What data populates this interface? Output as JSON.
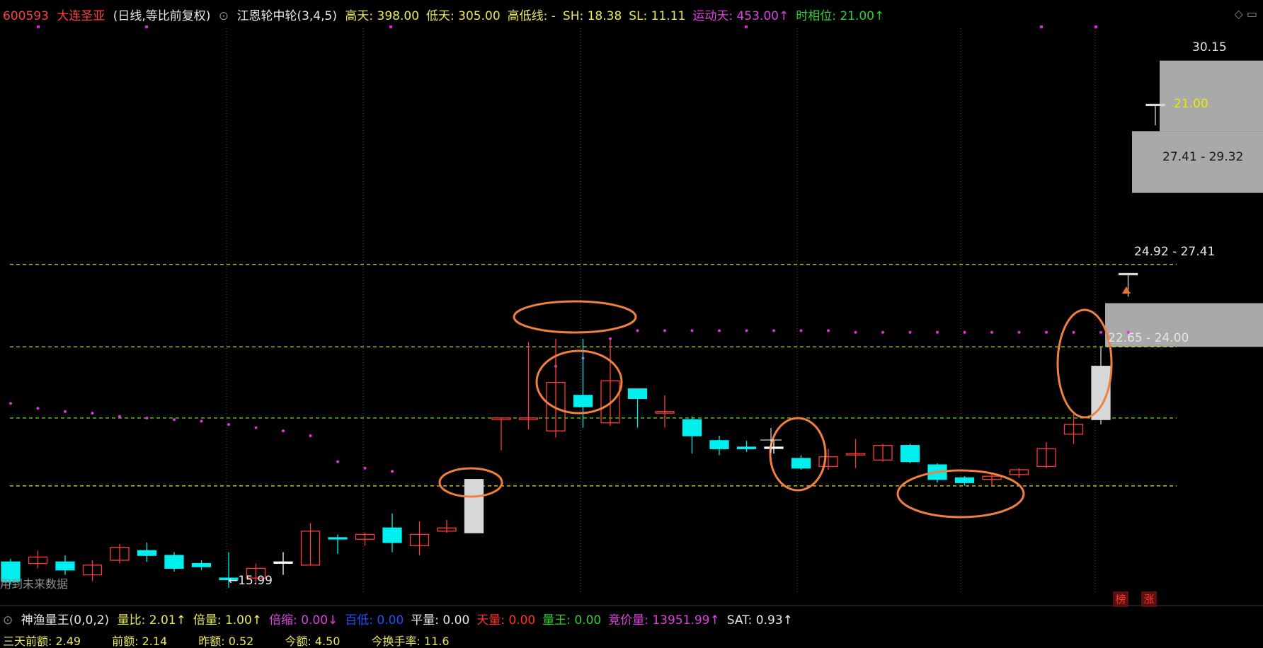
{
  "header": {
    "code": "600593",
    "name": "大连圣亚",
    "period": "(日线,等比前复权)",
    "indicator_name": "江恩轮中轮(3,4,5)",
    "items": [
      {
        "label": "高天: 398.00",
        "color": "#e8e85a"
      },
      {
        "label": "低天: 305.00",
        "color": "#e8e85a"
      },
      {
        "label": "高低线: -",
        "color": "#e8e85a"
      },
      {
        "label": "SH: 18.38",
        "color": "#e8e85a"
      },
      {
        "label": "SL: 11.11",
        "color": "#e8e85a"
      },
      {
        "label": "运动天: 453.00↑",
        "color": "#e040e0"
      },
      {
        "label": "时相位: 21.00↑",
        "color": "#30d030"
      }
    ]
  },
  "chart_data": {
    "type": "candlestick",
    "up_color": "#ff3b3b",
    "down_color": "#00f0f0",
    "limit_up_color": "#d8d8d8",
    "candles": [
      {
        "o": 15.4,
        "c": 16.0,
        "h": 16.1,
        "l": 15.3,
        "dir": "down"
      },
      {
        "o": 15.95,
        "c": 16.15,
        "h": 16.35,
        "l": 15.8,
        "dir": "up"
      },
      {
        "o": 16.0,
        "c": 15.75,
        "h": 16.2,
        "l": 15.6,
        "dir": "down"
      },
      {
        "o": 15.6,
        "c": 15.9,
        "h": 16.05,
        "l": 15.4,
        "dir": "up"
      },
      {
        "o": 16.05,
        "c": 16.45,
        "h": 16.55,
        "l": 15.95,
        "dir": "up"
      },
      {
        "o": 16.2,
        "c": 16.35,
        "h": 16.6,
        "l": 16.0,
        "dir": "down"
      },
      {
        "o": 16.2,
        "c": 15.8,
        "h": 16.3,
        "l": 15.7,
        "dir": "down"
      },
      {
        "o": 15.95,
        "c": 15.85,
        "h": 16.05,
        "l": 15.75,
        "dir": "down"
      },
      {
        "o": 15.45,
        "c": 15.5,
        "h": 16.3,
        "l": 15.2,
        "dir": "down"
      },
      {
        "o": 15.5,
        "c": 15.8,
        "h": 15.95,
        "l": 15.3,
        "dir": "up"
      },
      {
        "o": 16.0,
        "c": 16.0,
        "h": 16.3,
        "l": 15.6,
        "dir": "doji"
      },
      {
        "o": 15.9,
        "c": 16.95,
        "h": 17.2,
        "l": 15.9,
        "dir": "up"
      },
      {
        "o": 16.75,
        "c": 16.75,
        "h": 16.85,
        "l": 16.25,
        "dir": "down"
      },
      {
        "o": 16.7,
        "c": 16.85,
        "h": 16.9,
        "l": 16.5,
        "dir": "up"
      },
      {
        "o": 17.05,
        "c": 16.6,
        "h": 17.5,
        "l": 16.3,
        "dir": "down"
      },
      {
        "o": 16.5,
        "c": 16.85,
        "h": 17.25,
        "l": 16.2,
        "dir": "up"
      },
      {
        "o": 16.95,
        "c": 17.05,
        "h": 17.3,
        "l": 16.9,
        "dir": "up"
      },
      {
        "o": 16.9,
        "c": 18.55,
        "h": 18.55,
        "l": 16.9,
        "dir": "limit"
      },
      {
        "o": 20.45,
        "c": 20.45,
        "h": 20.45,
        "l": 19.45,
        "dir": "up"
      },
      {
        "o": 20.45,
        "c": 20.45,
        "h": 22.8,
        "l": 20.1,
        "dir": "up"
      },
      {
        "o": 20.05,
        "c": 21.55,
        "h": 22.9,
        "l": 19.85,
        "dir": "up"
      },
      {
        "o": 21.15,
        "c": 20.8,
        "h": 22.9,
        "l": 20.15,
        "dir": "down"
      },
      {
        "o": 20.3,
        "c": 21.6,
        "h": 22.9,
        "l": 20.2,
        "dir": "up"
      },
      {
        "o": 21.35,
        "c": 21.05,
        "h": 21.35,
        "l": 20.15,
        "dir": "down"
      },
      {
        "o": 20.6,
        "c": 20.65,
        "h": 21.15,
        "l": 20.15,
        "dir": "up"
      },
      {
        "o": 20.4,
        "c": 19.9,
        "h": 20.5,
        "l": 19.35,
        "dir": "down"
      },
      {
        "o": 19.75,
        "c": 19.5,
        "h": 19.9,
        "l": 19.3,
        "dir": "down"
      },
      {
        "o": 19.55,
        "c": 19.5,
        "h": 19.75,
        "l": 19.4,
        "dir": "down"
      },
      {
        "o": 19.55,
        "c": 19.55,
        "h": 19.75,
        "l": 19.35,
        "dir": "doji"
      },
      {
        "o": 19.2,
        "c": 18.9,
        "h": 19.3,
        "l": 18.85,
        "dir": "down"
      },
      {
        "o": 18.95,
        "c": 19.25,
        "h": 19.5,
        "l": 18.85,
        "dir": "up"
      },
      {
        "o": 19.35,
        "c": 19.35,
        "h": 19.8,
        "l": 18.9,
        "dir": "up"
      },
      {
        "o": 19.15,
        "c": 19.6,
        "h": 19.65,
        "l": 19.1,
        "dir": "up"
      },
      {
        "o": 19.6,
        "c": 19.1,
        "h": 19.65,
        "l": 19.05,
        "dir": "down"
      },
      {
        "o": 19.0,
        "c": 18.55,
        "h": 19.05,
        "l": 18.45,
        "dir": "down"
      },
      {
        "o": 18.6,
        "c": 18.45,
        "h": 18.65,
        "l": 18.35,
        "dir": "down"
      },
      {
        "o": 18.55,
        "c": 18.65,
        "h": 18.7,
        "l": 18.35,
        "dir": "up"
      },
      {
        "o": 18.7,
        "c": 18.85,
        "h": 18.9,
        "l": 18.6,
        "dir": "up"
      },
      {
        "o": 18.95,
        "c": 19.5,
        "h": 19.7,
        "l": 18.9,
        "dir": "up"
      },
      {
        "o": 19.95,
        "c": 20.25,
        "h": 20.6,
        "l": 19.65,
        "dir": "up"
      },
      {
        "o": 20.4,
        "c": 22.05,
        "h": 22.65,
        "l": 20.25,
        "dir": "limit"
      },
      {
        "o": 24.92,
        "c": 24.92,
        "h": 24.92,
        "l": 24.2,
        "dir": "limit"
      },
      {
        "o": 30.15,
        "c": 30.15,
        "h": 30.15,
        "l": 29.5,
        "dir": "limit"
      }
    ],
    "dots_series": [
      {
        "i": 0,
        "v": 20.9
      },
      {
        "i": 1,
        "v": 20.75
      },
      {
        "i": 2,
        "v": 20.65
      },
      {
        "i": 3,
        "v": 20.6
      },
      {
        "i": 4,
        "v": 20.5
      },
      {
        "i": 5,
        "v": 20.45
      },
      {
        "i": 6,
        "v": 20.4
      },
      {
        "i": 7,
        "v": 20.35
      },
      {
        "i": 8,
        "v": 20.25
      },
      {
        "i": 9,
        "v": 20.15
      },
      {
        "i": 10,
        "v": 20.05
      },
      {
        "i": 11,
        "v": 19.9
      },
      {
        "i": 12,
        "v": 19.1
      },
      {
        "i": 13,
        "v": 18.9
      },
      {
        "i": 14,
        "v": 18.8
      },
      {
        "i": 20,
        "v": 22.05
      },
      {
        "i": 21,
        "v": 22.3
      },
      {
        "i": 22,
        "v": 22.9
      },
      {
        "i": 23,
        "v": 23.15
      },
      {
        "i": 24,
        "v": 23.15
      },
      {
        "i": 25,
        "v": 23.15
      },
      {
        "i": 26,
        "v": 23.15
      },
      {
        "i": 27,
        "v": 23.15
      },
      {
        "i": 28,
        "v": 23.15
      },
      {
        "i": 29,
        "v": 23.15
      },
      {
        "i": 30,
        "v": 23.15
      },
      {
        "i": 31,
        "v": 23.1
      },
      {
        "i": 32,
        "v": 23.1
      },
      {
        "i": 33,
        "v": 23.1
      },
      {
        "i": 34,
        "v": 23.1
      },
      {
        "i": 35,
        "v": 23.1
      },
      {
        "i": 36,
        "v": 23.1
      },
      {
        "i": 37,
        "v": 23.1
      },
      {
        "i": 38,
        "v": 23.1
      },
      {
        "i": 39,
        "v": 23.1
      },
      {
        "i": 40,
        "v": 23.1
      },
      {
        "i": 41,
        "v": 23.1
      }
    ],
    "hlines": [
      {
        "v": 25.2,
        "color": "#d8d820"
      },
      {
        "v": 22.65,
        "color": "#b8e020"
      },
      {
        "v": 20.45,
        "color": "#6ee020"
      },
      {
        "v": 18.35,
        "color": "#e8e030"
      }
    ],
    "zones": [
      {
        "low": 29.32,
        "high": 31.5,
        "label": "21.00",
        "label_color": "#e8e800"
      },
      {
        "low": 27.41,
        "high": 29.32,
        "label": "27.41 - 29.32",
        "label_color": "#222222"
      },
      {
        "low": 22.65,
        "high": 24.0,
        "label": "22.65 - 24.00",
        "label_color": "#e6e6e6"
      }
    ],
    "labels": {
      "top_price": "30.15",
      "mid_zone": "24.92 - 27.41",
      "low_price": "←15.99",
      "future_note": "用到未来数据"
    },
    "ylim": [
      15.0,
      32.5
    ]
  },
  "indicator": {
    "name": "神渔量王(0,0,2)",
    "items": [
      {
        "label": "量比: 2.01↑",
        "color": "#e8e85a"
      },
      {
        "label": "倍量: 1.00↑",
        "color": "#e8e85a"
      },
      {
        "label": "倍缩: 0.00↓",
        "color": "#e040e0"
      },
      {
        "label": "百低: 0.00",
        "color": "#2050ff"
      },
      {
        "label": "平量: 0.00",
        "color": "#e6e6e6"
      },
      {
        "label": "天量: 0.00",
        "color": "#ff3030"
      },
      {
        "label": "量王: 0.00",
        "color": "#30d030"
      },
      {
        "label": "竞价量: 13951.99↑",
        "color": "#e040e0"
      },
      {
        "label": "SAT: 0.93↑",
        "color": "#e6e6e6"
      }
    ],
    "row2": [
      {
        "label": "三天前额: 2.49",
        "color": "#e8e85a"
      },
      {
        "label": "前额: 2.14",
        "color": "#e8e85a"
      },
      {
        "label": "昨额: 0.52",
        "color": "#e8e85a"
      },
      {
        "label": "今额: 4.50",
        "color": "#e8e85a"
      },
      {
        "label": "今换手率: 11.6",
        "color": "#e8e85a"
      }
    ]
  },
  "tags": [
    "榜",
    "涨"
  ]
}
